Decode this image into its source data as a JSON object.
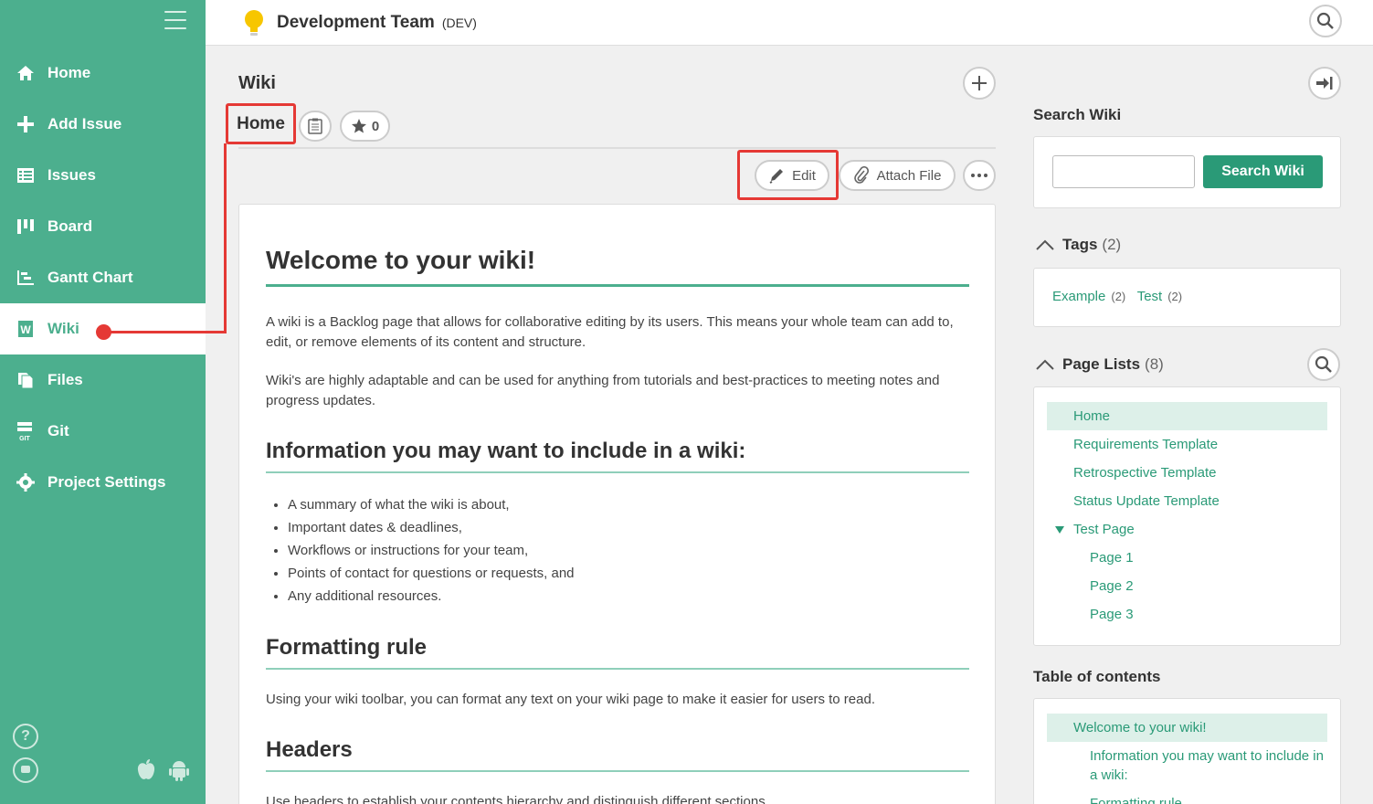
{
  "sidebar": {
    "items": [
      {
        "label": "Home",
        "icon": "home-icon"
      },
      {
        "label": "Add Issue",
        "icon": "plus-icon"
      },
      {
        "label": "Issues",
        "icon": "list-icon"
      },
      {
        "label": "Board",
        "icon": "board-icon"
      },
      {
        "label": "Gantt Chart",
        "icon": "gantt-icon"
      },
      {
        "label": "Wiki",
        "icon": "wiki-icon",
        "active": true
      },
      {
        "label": "Files",
        "icon": "files-icon"
      },
      {
        "label": "Git",
        "icon": "git-icon"
      },
      {
        "label": "Project Settings",
        "icon": "gear-icon"
      }
    ],
    "accent": "#4caf8e"
  },
  "header": {
    "project_name": "Development Team",
    "project_key": "(DEV)"
  },
  "main": {
    "section_title": "Wiki",
    "page_title": "Home",
    "star_count": "0",
    "edit_label": "Edit",
    "attach_label": "Attach File",
    "article": {
      "h1": "Welcome to your wiki!",
      "p1": "A wiki is a Backlog page that allows for collaborative editing by its users. This means your whole team can add to, edit, or remove elements of its content and structure.",
      "p2": "Wiki's are highly adaptable and can be used for anything from tutorials and best-practices to meeting notes and progress updates.",
      "h2a": "Information you may want to include in a wiki:",
      "list": [
        "A summary of what the wiki is about,",
        "Important dates & deadlines,",
        "Workflows or instructions for your team,",
        "Points of contact for questions or requests, and",
        "Any additional resources."
      ],
      "h2b": "Formatting rule",
      "p3": "Using your wiki toolbar, you can format any text on your wiki page to make it easier for users to read.",
      "h2c": "Headers",
      "p4": "Use headers to establish your contents hierarchy and distinguish different sections."
    }
  },
  "right": {
    "search_heading": "Search Wiki",
    "search_button": "Search Wiki",
    "tags_heading": "Tags",
    "tags_count": "(2)",
    "tags": [
      {
        "name": "Example",
        "count": "(2)"
      },
      {
        "name": "Test",
        "count": "(2)"
      }
    ],
    "pages_heading": "Page Lists",
    "pages_count": "(8)",
    "pages": [
      {
        "label": "Home"
      },
      {
        "label": "Requirements Template"
      },
      {
        "label": "Retrospective Template"
      },
      {
        "label": "Status Update Template"
      },
      {
        "label": "Test Page"
      },
      {
        "label": "Page 1"
      },
      {
        "label": "Page 2"
      },
      {
        "label": "Page 3"
      }
    ],
    "toc_heading": "Table of contents",
    "toc": [
      {
        "label": "Welcome to your wiki!"
      },
      {
        "label": "Information you may want to include in a wiki:"
      },
      {
        "label": "Formatting rule"
      }
    ]
  }
}
